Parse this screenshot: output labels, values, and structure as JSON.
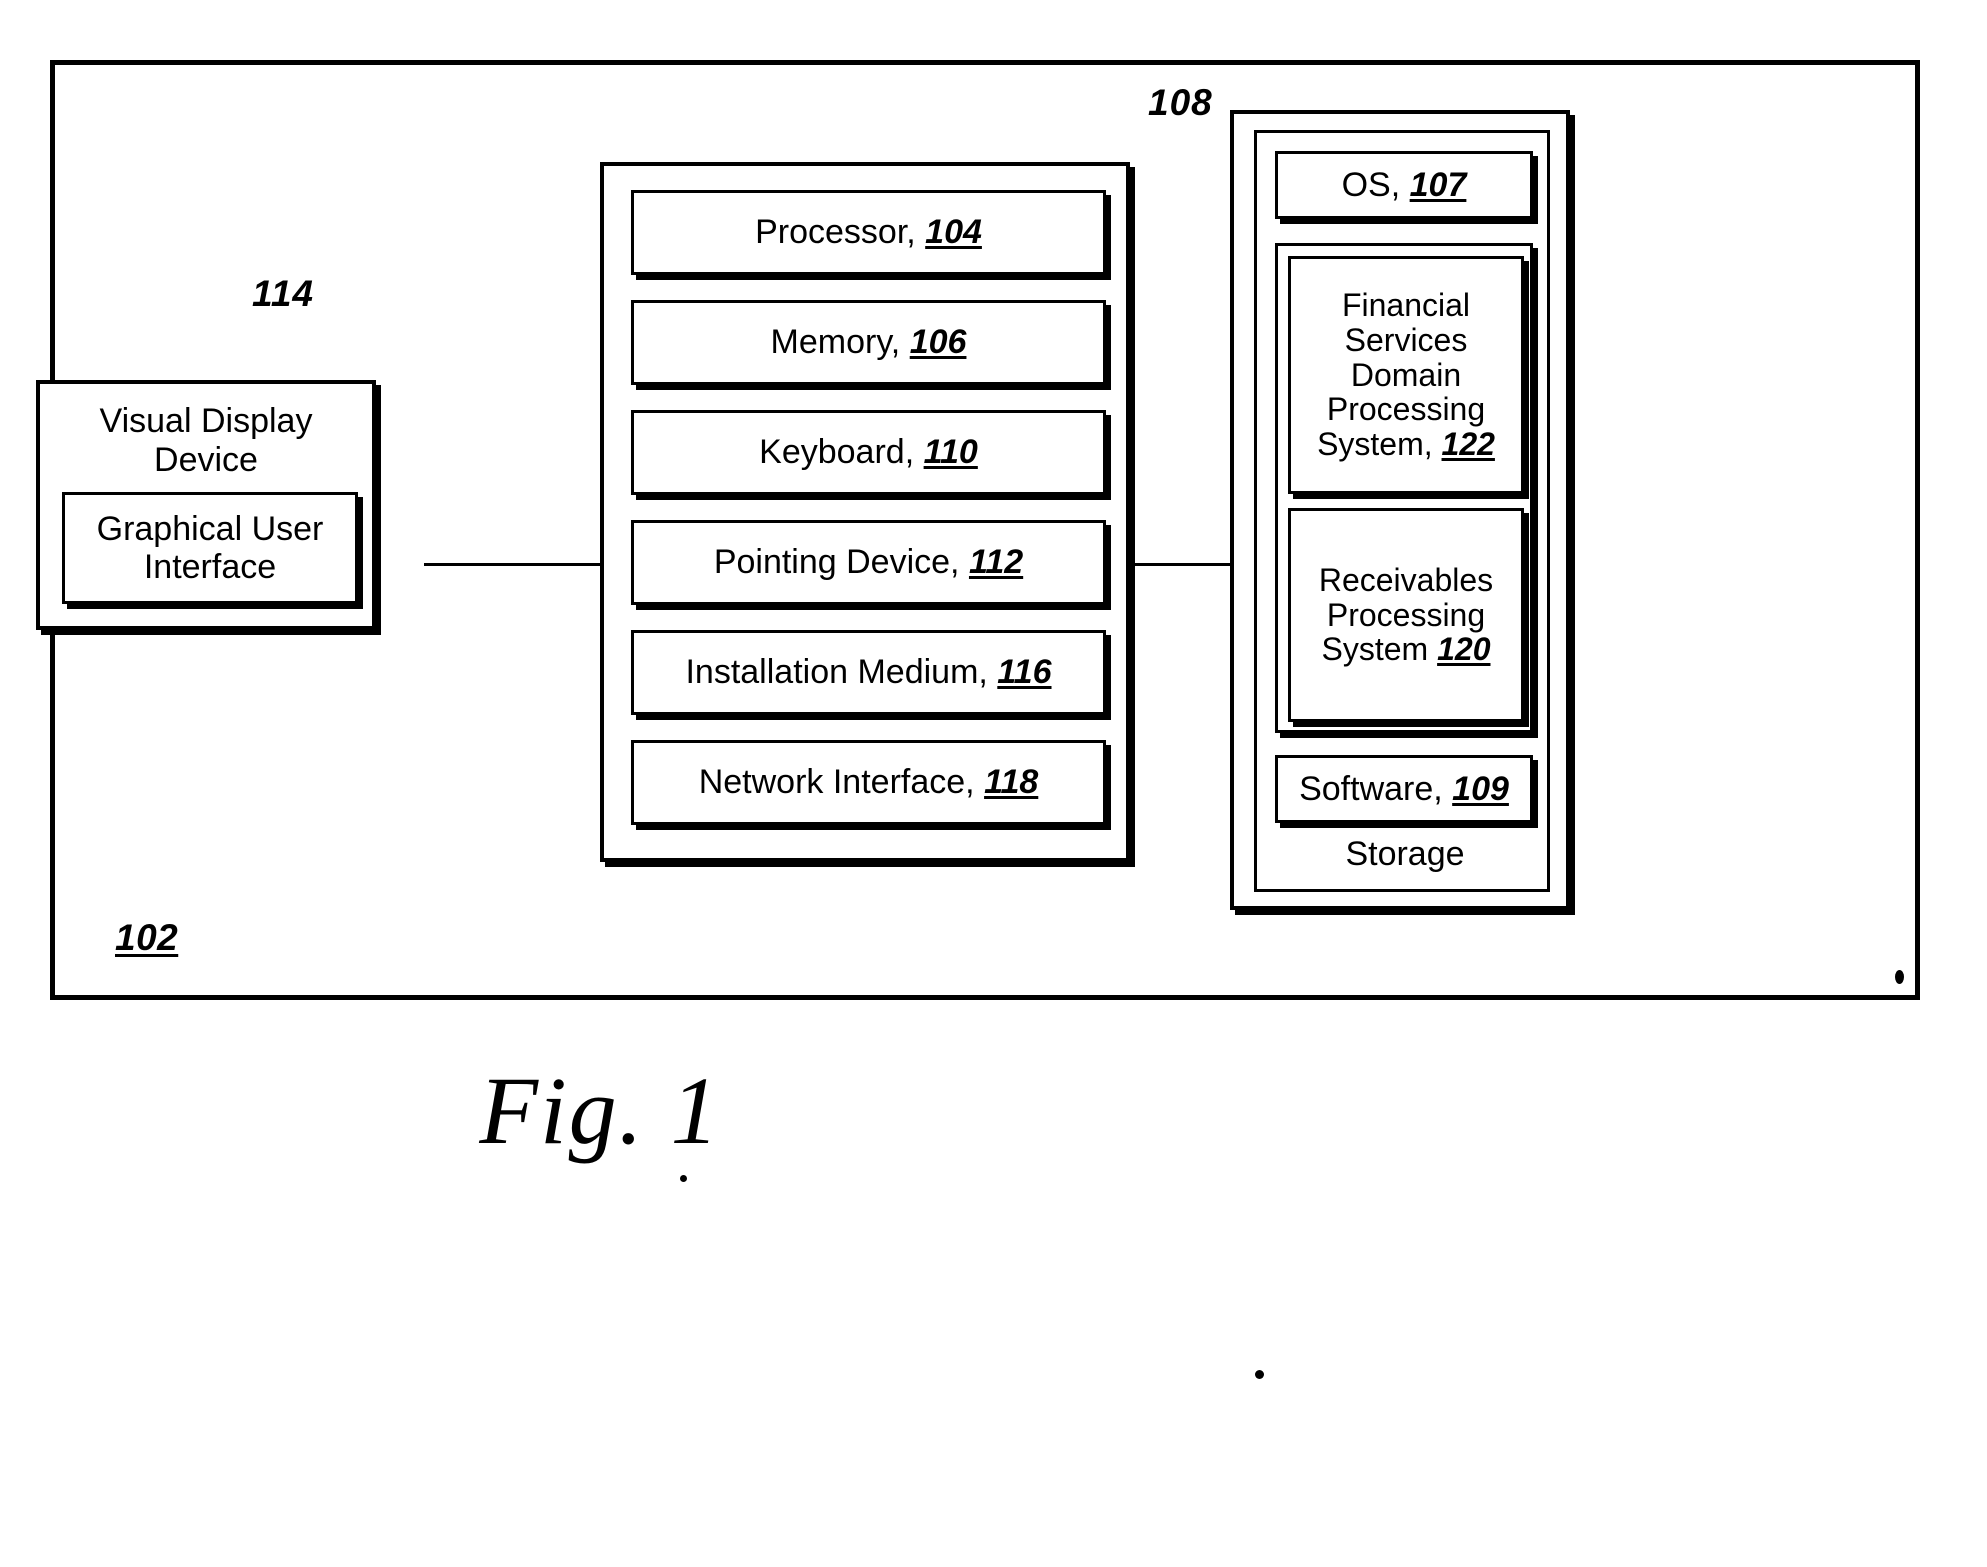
{
  "figure": {
    "caption": "Fig. 1",
    "system_ref": "102"
  },
  "display": {
    "title_line1": "Visual Display",
    "title_line2": "Device",
    "gui_line1": "Graphical User",
    "gui_line2": "Interface",
    "ref": "114"
  },
  "computer": {
    "items": [
      {
        "label": "Processor,",
        "ref": "104"
      },
      {
        "label": "Memory,",
        "ref": "106"
      },
      {
        "label": "Keyboard,",
        "ref": "110"
      },
      {
        "label": "Pointing Device,",
        "ref": "112"
      },
      {
        "label": "Installation Medium,",
        "ref": "116"
      },
      {
        "label": "Network Interface,",
        "ref": "118"
      }
    ]
  },
  "storage": {
    "ref": "108",
    "caption": "Storage",
    "os": {
      "label": "OS,",
      "ref": "107"
    },
    "financial": {
      "line1": "Financial",
      "line2": "Services",
      "line3": "Domain",
      "line4": "Processing",
      "line5": "System,",
      "ref": "122"
    },
    "receivables": {
      "line1": "Receivables",
      "line2": "Processing",
      "line3": "System",
      "ref": "120"
    },
    "software": {
      "label": "Software,",
      "ref": "109"
    }
  },
  "colors": {
    "ink": "#000000",
    "paper": "#ffffff"
  }
}
